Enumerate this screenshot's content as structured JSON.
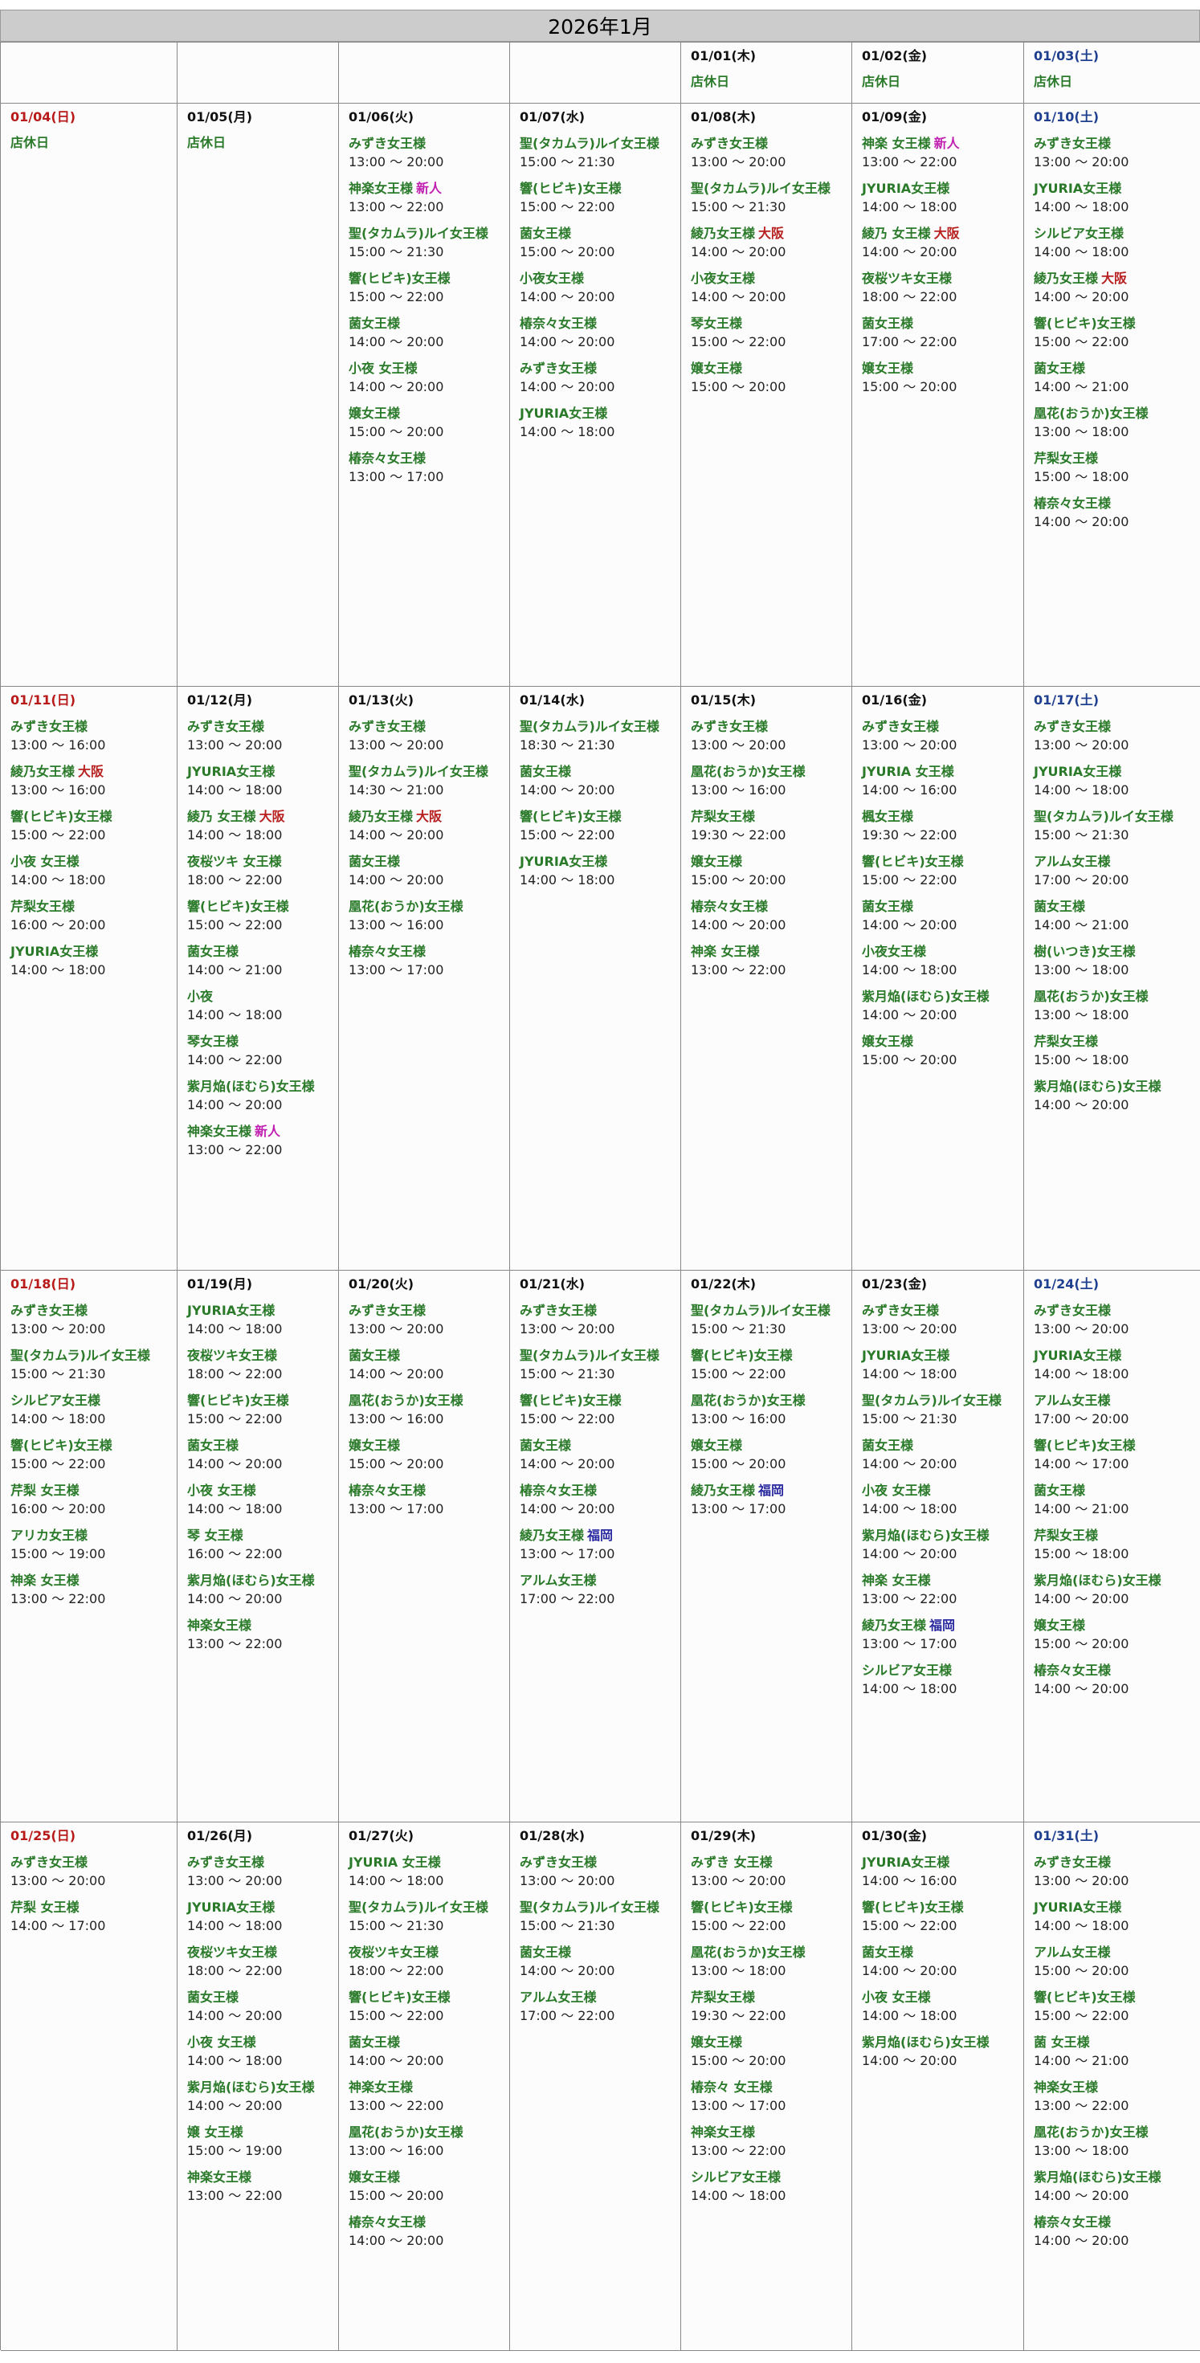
{
  "title": "2026年1月",
  "closed_label": "店休日",
  "tag_types": {
    "新人": "new",
    "大阪": "osaka",
    "福岡": "fukuoka"
  },
  "weeks": [
    [
      {
        "date": ""
      },
      {
        "date": ""
      },
      {
        "date": ""
      },
      {
        "date": ""
      },
      {
        "date": "01/01(木)",
        "closed": true
      },
      {
        "date": "01/02(金)",
        "closed": true
      },
      {
        "date": "01/03(土)",
        "closed": true
      }
    ],
    [
      {
        "date": "01/04(日)",
        "closed": true
      },
      {
        "date": "01/05(月)",
        "closed": true
      },
      {
        "date": "01/06(火)",
        "entries": [
          {
            "name": "みずき女王様",
            "time": "13:00 ～ 20:00"
          },
          {
            "name": "神楽女王様",
            "tag": "新人",
            "time": "13:00 ～ 22:00"
          },
          {
            "name": "聖(タカムラ)ルイ女王様",
            "time": "15:00 ～ 21:30"
          },
          {
            "name": "響(ヒビキ)女王様",
            "time": "15:00 ～ 22:00"
          },
          {
            "name": "菌女王様",
            "time": "14:00 ～ 20:00"
          },
          {
            "name": "小夜 女王様",
            "time": "14:00 ～ 20:00"
          },
          {
            "name": "嬢女王様",
            "time": "15:00 ～ 20:00"
          },
          {
            "name": "椿奈々女王様",
            "time": "13:00 ～ 17:00"
          }
        ]
      },
      {
        "date": "01/07(水)",
        "entries": [
          {
            "name": "聖(タカムラ)ルイ女王様",
            "time": "15:00 ～ 21:30"
          },
          {
            "name": "響(ヒビキ)女王様",
            "time": "15:00 ～ 22:00"
          },
          {
            "name": "菌女王様",
            "time": "15:00 ～ 20:00"
          },
          {
            "name": "小夜女王様",
            "time": "14:00 ～ 20:00"
          },
          {
            "name": "椿奈々女王様",
            "time": "14:00 ～ 20:00"
          },
          {
            "name": "みずき女王様",
            "time": "14:00 ～ 20:00"
          },
          {
            "name": "JYURIA女王様",
            "time": "14:00 ～ 18:00"
          }
        ]
      },
      {
        "date": "01/08(木)",
        "entries": [
          {
            "name": "みずき女王様",
            "time": "13:00 ～ 20:00"
          },
          {
            "name": "聖(タカムラ)ルイ女王様",
            "time": "15:00 ～ 21:30"
          },
          {
            "name": "綾乃女王様",
            "tag": "大阪",
            "time": "14:00 ～ 20:00"
          },
          {
            "name": "小夜女王様",
            "time": "14:00 ～ 20:00"
          },
          {
            "name": "琴女王様",
            "time": "15:00 ～ 22:00"
          },
          {
            "name": "嬢女王様",
            "time": "15:00 ～ 20:00"
          }
        ]
      },
      {
        "date": "01/09(金)",
        "entries": [
          {
            "name": "神楽 女王様",
            "tag": "新人",
            "time": "13:00 ～ 22:00"
          },
          {
            "name": "JYURIA女王様",
            "time": "14:00 ～ 18:00"
          },
          {
            "name": "綾乃 女王様",
            "tag": "大阪",
            "time": "14:00 ～ 20:00"
          },
          {
            "name": "夜桜ツキ女王様",
            "time": "18:00 ～ 22:00"
          },
          {
            "name": "菌女王様",
            "time": "17:00 ～ 22:00"
          },
          {
            "name": "嬢女王様",
            "time": "15:00 ～ 20:00"
          }
        ]
      },
      {
        "date": "01/10(土)",
        "entries": [
          {
            "name": "みずき女王様",
            "time": "13:00 ～ 20:00"
          },
          {
            "name": "JYURIA女王様",
            "time": "14:00 ～ 18:00"
          },
          {
            "name": "シルビア女王様",
            "time": "14:00 ～ 18:00"
          },
          {
            "name": "綾乃女王様",
            "tag": "大阪",
            "time": "14:00 ～ 20:00"
          },
          {
            "name": "響(ヒビキ)女王様",
            "time": "15:00 ～ 22:00"
          },
          {
            "name": "菌女王様",
            "time": "14:00 ～ 21:00"
          },
          {
            "name": "凰花(おうか)女王様",
            "time": "13:00 ～ 18:00"
          },
          {
            "name": "芹梨女王様",
            "time": "15:00 ～ 18:00"
          },
          {
            "name": "椿奈々女王様",
            "time": "14:00 ～ 20:00"
          }
        ]
      }
    ],
    [
      {
        "date": "01/11(日)",
        "entries": [
          {
            "name": "みずき女王様",
            "time": "13:00 ～ 16:00"
          },
          {
            "name": "綾乃女王様",
            "tag": "大阪",
            "time": "13:00 ～ 16:00"
          },
          {
            "name": "響(ヒビキ)女王様",
            "time": "15:00 ～ 22:00"
          },
          {
            "name": "小夜 女王様",
            "time": "14:00 ～ 18:00"
          },
          {
            "name": "芹梨女王様",
            "time": "16:00 ～ 20:00"
          },
          {
            "name": "JYURIA女王様",
            "time": "14:00 ～ 18:00"
          }
        ]
      },
      {
        "date": "01/12(月)",
        "entries": [
          {
            "name": "みずき女王様",
            "time": "13:00 ～ 20:00"
          },
          {
            "name": "JYURIA女王様",
            "time": "14:00 ～ 18:00"
          },
          {
            "name": "綾乃 女王様",
            "tag": "大阪",
            "time": "14:00 ～ 18:00"
          },
          {
            "name": "夜桜ツキ 女王様",
            "time": "18:00 ～ 22:00"
          },
          {
            "name": "響(ヒビキ)女王様",
            "time": "15:00 ～ 22:00"
          },
          {
            "name": "菌女王様",
            "time": "14:00 ～ 21:00"
          },
          {
            "name": "小夜",
            "time": "14:00 ～ 18:00"
          },
          {
            "name": "琴女王様",
            "time": "14:00 ～ 22:00"
          },
          {
            "name": "紫月焔(ほむら)女王様",
            "time": "14:00 ～ 20:00"
          },
          {
            "name": "神楽女王様",
            "tag": "新人",
            "time": "13:00 ～ 22:00"
          }
        ]
      },
      {
        "date": "01/13(火)",
        "entries": [
          {
            "name": "みずき女王様",
            "time": "13:00 ～ 20:00"
          },
          {
            "name": "聖(タカムラ)ルイ女王様",
            "time": "14:30 ～ 21:00"
          },
          {
            "name": "綾乃女王様",
            "tag": "大阪",
            "time": "14:00 ～ 20:00"
          },
          {
            "name": "菌女王様",
            "time": "14:00 ～ 20:00"
          },
          {
            "name": "凰花(おうか)女王様",
            "time": "13:00 ～ 16:00"
          },
          {
            "name": "椿奈々女王様",
            "time": "13:00 ～ 17:00"
          }
        ]
      },
      {
        "date": "01/14(水)",
        "entries": [
          {
            "name": "聖(タカムラ)ルイ女王様",
            "time": "18:30 ～ 21:30"
          },
          {
            "name": "菌女王様",
            "time": "14:00 ～ 20:00"
          },
          {
            "name": "響(ヒビキ)女王様",
            "time": "15:00 ～ 22:00"
          },
          {
            "name": "JYURIA女王様",
            "time": "14:00 ～ 18:00"
          }
        ]
      },
      {
        "date": "01/15(木)",
        "entries": [
          {
            "name": "みずき女王様",
            "time": "13:00 ～ 20:00"
          },
          {
            "name": "凰花(おうか)女王様",
            "time": "13:00 ～ 16:00"
          },
          {
            "name": "芹梨女王様",
            "time": "19:30 ～ 22:00"
          },
          {
            "name": "嬢女王様",
            "time": "15:00 ～ 20:00"
          },
          {
            "name": "椿奈々女王様",
            "time": "14:00 ～ 20:00"
          },
          {
            "name": "神楽 女王様",
            "time": "13:00 ～ 22:00"
          }
        ]
      },
      {
        "date": "01/16(金)",
        "entries": [
          {
            "name": "みずき女王様",
            "time": "13:00 ～ 20:00"
          },
          {
            "name": "JYURIA 女王様",
            "time": "14:00 ～ 16:00"
          },
          {
            "name": "楓女王様",
            "time": "19:30 ～ 22:00"
          },
          {
            "name": "響(ヒビキ)女王様",
            "time": "15:00 ～ 22:00"
          },
          {
            "name": "菌女王様",
            "time": "14:00 ～ 20:00"
          },
          {
            "name": "小夜女王様",
            "time": "14:00 ～ 18:00"
          },
          {
            "name": "紫月焔(ほむら)女王様",
            "time": "14:00 ～ 20:00"
          },
          {
            "name": "嬢女王様",
            "time": "15:00 ～ 20:00"
          }
        ]
      },
      {
        "date": "01/17(土)",
        "entries": [
          {
            "name": "みずき女王様",
            "time": "13:00 ～ 20:00"
          },
          {
            "name": "JYURIA女王様",
            "time": "14:00 ～ 18:00"
          },
          {
            "name": "聖(タカムラ)ルイ女王様",
            "time": "15:00 ～ 21:30"
          },
          {
            "name": "アルム女王様",
            "time": "17:00 ～ 20:00"
          },
          {
            "name": "菌女王様",
            "time": "14:00 ～ 21:00"
          },
          {
            "name": "樹(いつき)女王様",
            "time": "13:00 ～ 18:00"
          },
          {
            "name": "凰花(おうか)女王様",
            "time": "13:00 ～ 18:00"
          },
          {
            "name": "芹梨女王様",
            "time": "15:00 ～ 18:00"
          },
          {
            "name": "紫月焔(ほむら)女王様",
            "time": "14:00 ～ 20:00"
          }
        ]
      }
    ],
    [
      {
        "date": "01/18(日)",
        "entries": [
          {
            "name": "みずき女王様",
            "time": "13:00 ～ 20:00"
          },
          {
            "name": "聖(タカムラ)ルイ女王様",
            "time": "15:00 ～ 21:30"
          },
          {
            "name": "シルビア女王様",
            "time": "14:00 ～ 18:00"
          },
          {
            "name": "響(ヒビキ)女王様",
            "time": "15:00 ～ 22:00"
          },
          {
            "name": "芹梨 女王様",
            "time": "16:00 ～ 20:00"
          },
          {
            "name": "アリカ女王様",
            "time": "15:00 ～ 19:00"
          },
          {
            "name": "神楽 女王様",
            "time": "13:00 ～ 22:00"
          }
        ]
      },
      {
        "date": "01/19(月)",
        "entries": [
          {
            "name": "JYURIA女王様",
            "time": "14:00 ～ 18:00"
          },
          {
            "name": "夜桜ツキ女王様",
            "time": "18:00 ～ 22:00"
          },
          {
            "name": "響(ヒビキ)女王様",
            "time": "15:00 ～ 22:00"
          },
          {
            "name": "菌女王様",
            "time": "14:00 ～ 20:00"
          },
          {
            "name": "小夜 女王様",
            "time": "14:00 ～ 18:00"
          },
          {
            "name": "琴 女王様",
            "time": "16:00 ～ 22:00"
          },
          {
            "name": "紫月焔(ほむら)女王様",
            "time": "14:00 ～ 20:00"
          },
          {
            "name": "神楽女王様",
            "time": "13:00 ～ 22:00"
          }
        ]
      },
      {
        "date": "01/20(火)",
        "entries": [
          {
            "name": "みずき女王様",
            "time": "13:00 ～ 20:00"
          },
          {
            "name": "菌女王様",
            "time": "14:00 ～ 20:00"
          },
          {
            "name": "凰花(おうか)女王様",
            "time": "13:00 ～ 16:00"
          },
          {
            "name": "嬢女王様",
            "time": "15:00 ～ 20:00"
          },
          {
            "name": "椿奈々女王様",
            "time": "13:00 ～ 17:00"
          }
        ]
      },
      {
        "date": "01/21(水)",
        "entries": [
          {
            "name": "みずき女王様",
            "time": "13:00 ～ 20:00"
          },
          {
            "name": "聖(タカムラ)ルイ女王様",
            "time": "15:00 ～ 21:30"
          },
          {
            "name": "響(ヒビキ)女王様",
            "time": "15:00 ～ 22:00"
          },
          {
            "name": "菌女王様",
            "time": "14:00 ～ 20:00"
          },
          {
            "name": "椿奈々女王様",
            "time": "14:00 ～ 20:00"
          },
          {
            "name": "綾乃女王様",
            "tag": "福岡",
            "time": "13:00 ～ 17:00"
          },
          {
            "name": "アルム女王様",
            "time": "17:00 ～ 22:00"
          }
        ]
      },
      {
        "date": "01/22(木)",
        "entries": [
          {
            "name": "聖(タカムラ)ルイ女王様",
            "time": "15:00 ～ 21:30"
          },
          {
            "name": "響(ヒビキ)女王様",
            "time": "15:00 ～ 22:00"
          },
          {
            "name": "凰花(おうか)女王様",
            "time": "13:00 ～ 16:00"
          },
          {
            "name": "嬢女王様",
            "time": "15:00 ～ 20:00"
          },
          {
            "name": "綾乃女王様",
            "tag": "福岡",
            "time": "13:00 ～ 17:00"
          }
        ]
      },
      {
        "date": "01/23(金)",
        "entries": [
          {
            "name": "みずき女王様",
            "time": "13:00 ～ 20:00"
          },
          {
            "name": "JYURIA女王様",
            "time": "14:00 ～ 18:00"
          },
          {
            "name": "聖(タカムラ)ルイ女王様",
            "time": "15:00 ～ 21:30"
          },
          {
            "name": "菌女王様",
            "time": "14:00 ～ 20:00"
          },
          {
            "name": "小夜 女王様",
            "time": "14:00 ～ 18:00"
          },
          {
            "name": "紫月焔(ほむら)女王様",
            "time": "14:00 ～ 20:00"
          },
          {
            "name": "神楽 女王様",
            "time": "13:00 ～ 22:00"
          },
          {
            "name": "綾乃女王様",
            "tag": "福岡",
            "time": "13:00 ～ 17:00"
          },
          {
            "name": "シルビア女王様",
            "time": "14:00 ～ 18:00"
          }
        ]
      },
      {
        "date": "01/24(土)",
        "entries": [
          {
            "name": "みずき女王様",
            "time": "13:00 ～ 20:00"
          },
          {
            "name": "JYURIA女王様",
            "time": "14:00 ～ 18:00"
          },
          {
            "name": "アルム女王様",
            "time": "17:00 ～ 20:00"
          },
          {
            "name": "響(ヒビキ)女王様",
            "time": "14:00 ～ 17:00"
          },
          {
            "name": "菌女王様",
            "time": "14:00 ～ 21:00"
          },
          {
            "name": "芹梨女王様",
            "time": "15:00 ～ 18:00"
          },
          {
            "name": "紫月焔(ほむら)女王様",
            "time": "14:00 ～ 20:00"
          },
          {
            "name": "嬢女王様",
            "time": "15:00 ～ 20:00"
          },
          {
            "name": "椿奈々女王様",
            "time": "14:00 ～ 20:00"
          }
        ]
      }
    ],
    [
      {
        "date": "01/25(日)",
        "entries": [
          {
            "name": "みずき女王様",
            "time": "13:00 ～ 20:00"
          },
          {
            "name": "芹梨 女王様",
            "time": "14:00 ～ 17:00"
          }
        ]
      },
      {
        "date": "01/26(月)",
        "entries": [
          {
            "name": "みずき女王様",
            "time": "13:00 ～ 20:00"
          },
          {
            "name": "JYURIA女王様",
            "time": "14:00 ～ 18:00"
          },
          {
            "name": "夜桜ツキ女王様",
            "time": "18:00 ～ 22:00"
          },
          {
            "name": "菌女王様",
            "time": "14:00 ～ 20:00"
          },
          {
            "name": "小夜 女王様",
            "time": "14:00 ～ 18:00"
          },
          {
            "name": "紫月焔(ほむら)女王様",
            "time": "14:00 ～ 20:00"
          },
          {
            "name": "嬢 女王様",
            "time": "15:00 ～ 19:00"
          },
          {
            "name": "神楽女王様",
            "time": "13:00 ～ 22:00"
          }
        ]
      },
      {
        "date": "01/27(火)",
        "entries": [
          {
            "name": "JYURIA 女王様",
            "time": "14:00 ～ 18:00"
          },
          {
            "name": "聖(タカムラ)ルイ女王様",
            "time": "15:00 ～ 21:30"
          },
          {
            "name": "夜桜ツキ女王様",
            "time": "18:00 ～ 22:00"
          },
          {
            "name": "響(ヒビキ)女王様",
            "time": "15:00 ～ 22:00"
          },
          {
            "name": "菌女王様",
            "time": "14:00 ～ 20:00"
          },
          {
            "name": "神楽女王様",
            "time": "13:00 ～ 22:00"
          },
          {
            "name": "凰花(おうか)女王様",
            "time": "13:00 ～ 16:00"
          },
          {
            "name": "嬢女王様",
            "time": "15:00 ～ 20:00"
          },
          {
            "name": "椿奈々女王様",
            "time": "14:00 ～ 20:00"
          }
        ]
      },
      {
        "date": "01/28(水)",
        "entries": [
          {
            "name": "みずき女王様",
            "time": "13:00 ～ 20:00"
          },
          {
            "name": "聖(タカムラ)ルイ女王様",
            "time": "15:00 ～ 21:30"
          },
          {
            "name": "菌女王様",
            "time": "14:00 ～ 20:00"
          },
          {
            "name": "アルム女王様",
            "time": "17:00 ～ 22:00"
          }
        ]
      },
      {
        "date": "01/29(木)",
        "entries": [
          {
            "name": "みずき 女王様",
            "time": "13:00 ～ 20:00"
          },
          {
            "name": "響(ヒビキ)女王様",
            "time": "15:00 ～ 22:00"
          },
          {
            "name": "凰花(おうか)女王様",
            "time": "13:00 ～ 18:00"
          },
          {
            "name": "芹梨女王様",
            "time": "19:30 ～ 22:00"
          },
          {
            "name": "嬢女王様",
            "time": "15:00 ～ 20:00"
          },
          {
            "name": "椿奈々 女王様",
            "time": "13:00 ～ 17:00"
          },
          {
            "name": "神楽女王様",
            "time": "13:00 ～ 22:00"
          },
          {
            "name": "シルビア女王様",
            "time": "14:00 ～ 18:00"
          }
        ]
      },
      {
        "date": "01/30(金)",
        "entries": [
          {
            "name": "JYURIA女王様",
            "time": "14:00 ～ 16:00"
          },
          {
            "name": "響(ヒビキ)女王様",
            "time": "15:00 ～ 22:00"
          },
          {
            "name": "菌女王様",
            "time": "14:00 ～ 20:00"
          },
          {
            "name": "小夜 女王様",
            "time": "14:00 ～ 18:00"
          },
          {
            "name": "紫月焔(ほむら)女王様",
            "time": "14:00 ～ 20:00"
          }
        ]
      },
      {
        "date": "01/31(土)",
        "entries": [
          {
            "name": "みずき女王様",
            "time": "13:00 ～ 20:00"
          },
          {
            "name": "JYURIA女王様",
            "time": "14:00 ～ 18:00"
          },
          {
            "name": "アルム女王様",
            "time": "15:00 ～ 20:00"
          },
          {
            "name": "響(ヒビキ)女王様",
            "time": "15:00 ～ 22:00"
          },
          {
            "name": "菌 女王様",
            "time": "14:00 ～ 21:00"
          },
          {
            "name": "神楽女王様",
            "time": "13:00 ～ 22:00"
          },
          {
            "name": "凰花(おうか)女王様",
            "time": "13:00 ～ 18:00"
          },
          {
            "name": "紫月焔(ほむら)女王様",
            "time": "14:00 ～ 20:00"
          },
          {
            "name": "椿奈々女王様",
            "time": "14:00 ～ 20:00"
          }
        ]
      }
    ]
  ]
}
